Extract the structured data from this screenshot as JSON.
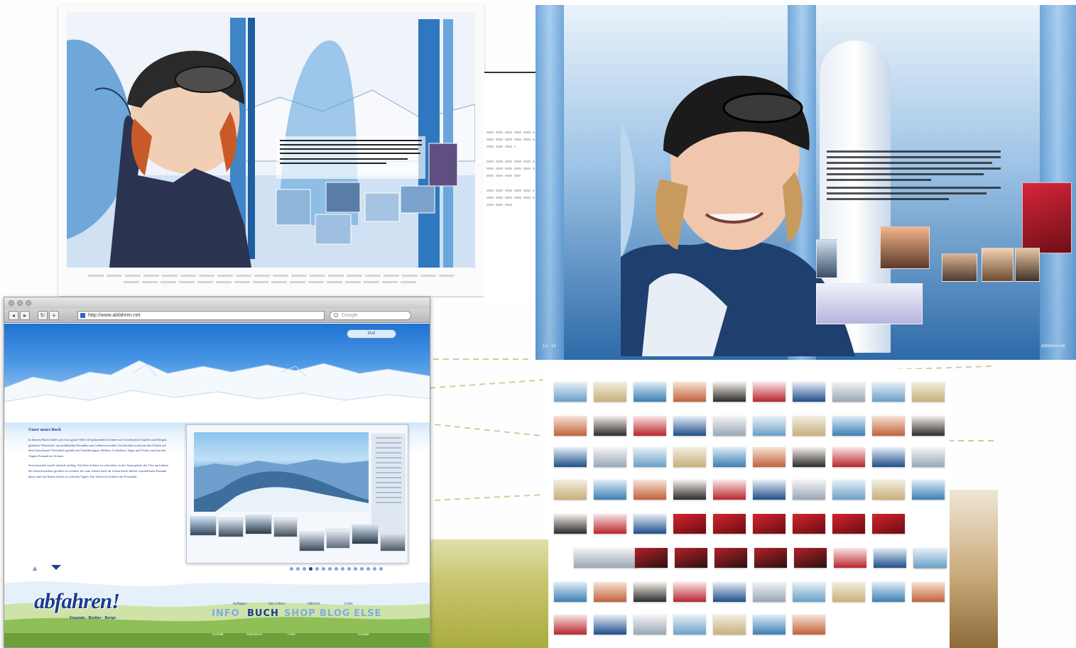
{
  "browser": {
    "url": "http://www.abfahren.net",
    "search_placeholder": "Google",
    "login_label": "Mail",
    "nav_back": "◂",
    "nav_forward": "▸",
    "nav_reload": "↻",
    "nav_add": "+"
  },
  "site": {
    "intro_heading": "Unser neues Buch",
    "intro_p1": "In diesem Buch findet sich eine ganze Welt voll glitzerndem Schnee auf verschneiten Gipfeln und Bergen, glasklare Winterluft, ausstrahlenden Freunden und schneeverwehter Geschichten rund um den Urlaub auf dem Snowboard. Persönlich gefüllt mit Schilderungen, Bildern, Gedichten, Tipps und Tricks rund um die Alpine Freunde im Schnee.",
    "intro_p2": "Snowboarden macht einfach süchtig. Auf dem Schnee zu schweben, in der Atmosphäre der Orte und neben den Snowboardern gesehen zu werden, bis zum Abend nach im Leben durch diesen wunderbaren Kontakt dann rund um Ihnen stehen zu weiteren Tagen. Ein Leben im Schnee mit Freunden.",
    "logo": "abfahren!",
    "tagline": "Freunde · Bretter · Berge",
    "nav_sub": [
      "Auflagen",
      "das Leben",
      "hilfreich",
      "Links"
    ],
    "nav_main": [
      "INFO",
      "BUCH",
      "SHOP",
      "BLOG",
      "ELSE"
    ],
    "nav_current_index": 1,
    "bottom_links": [
      "Kontakt",
      "Impressum",
      "Links",
      "Kontakt"
    ],
    "pager_up": "▲",
    "pager_total_dots": 15,
    "pager_active_dot": 3
  },
  "spreads": {
    "folio_left": "12 · 13",
    "folio_right": "abfahren.net"
  },
  "colors": {
    "brand_blue": "#1a3b93",
    "sky_blue": "#4b97e6",
    "nav_inactive": "#7eaedf"
  }
}
